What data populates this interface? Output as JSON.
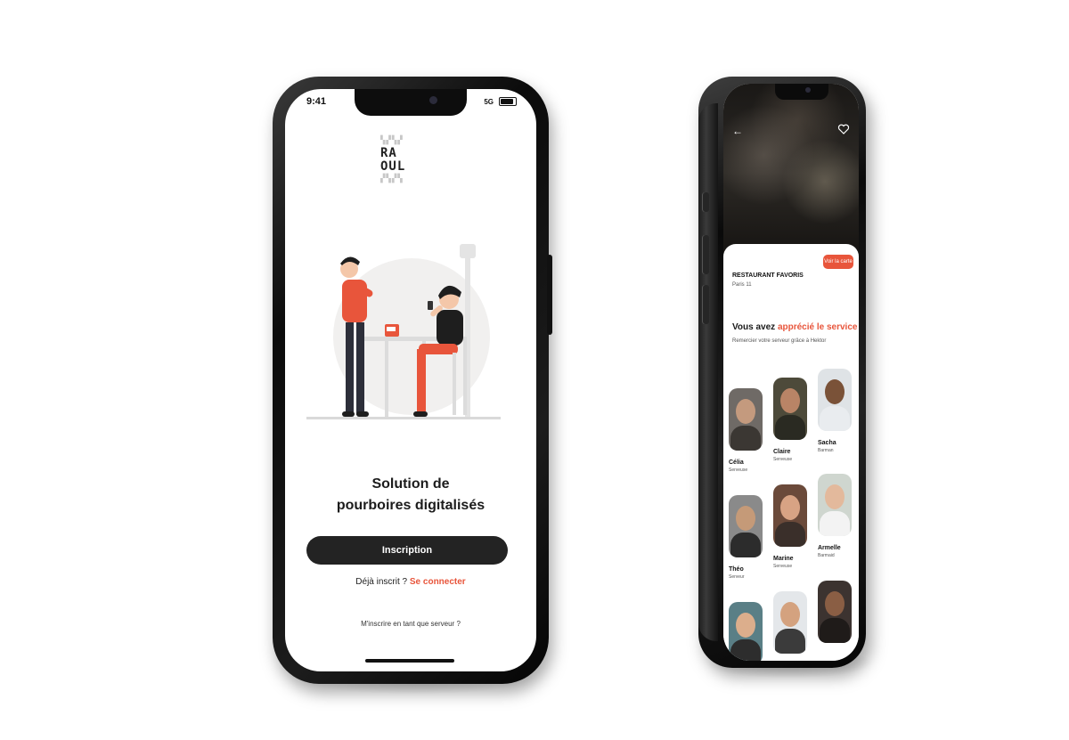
{
  "left_phone": {
    "status": {
      "time": "9:41",
      "network": "5G"
    },
    "logo": {
      "line_top": "▚▞▚▞",
      "line1": "RA",
      "line2": "OUL",
      "line_bottom": "▞▚▞▚"
    },
    "headline": {
      "line1": "Solution de",
      "line2": "pourboires digitalisés"
    },
    "cta_label": "Inscription",
    "login": {
      "prompt": "Déjà inscrit ?",
      "link": "Se connecter"
    },
    "server_link": "M'inscrire en tant que serveur ?"
  },
  "right_phone": {
    "map_button": "Voir la carte",
    "restaurant": {
      "name": "RESTAURANT FAVORIS",
      "location": "Paris 11"
    },
    "question": {
      "prefix": "Vous avez",
      "highlight": "apprécié le service",
      "suffix": "?"
    },
    "subtitle": "Remercier votre serveur grâce à Hektor",
    "staff": [
      {
        "name": "Célia",
        "role": "Serveuse"
      },
      {
        "name": "Claire",
        "role": "Serveuse"
      },
      {
        "name": "Sacha",
        "role": "Barman"
      },
      {
        "name": "Théo",
        "role": "Serveur"
      },
      {
        "name": "Marine",
        "role": "Serveuse"
      },
      {
        "name": "Armelle",
        "role": "Barmaid"
      },
      {
        "name": "",
        "role": ""
      },
      {
        "name": "",
        "role": ""
      },
      {
        "name": "",
        "role": ""
      }
    ]
  },
  "colors": {
    "accent": "#e8553b",
    "dark": "#232323",
    "background": "#ffffff"
  }
}
